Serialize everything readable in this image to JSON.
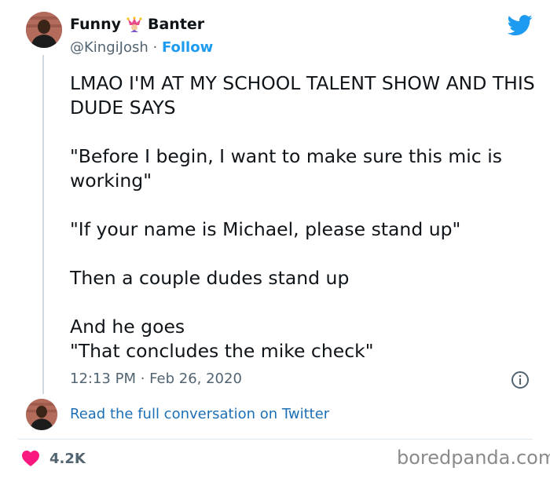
{
  "author": {
    "display_name_first": "Funny",
    "display_name_second": "Banter",
    "handle": "@KingiJosh",
    "separator": "·",
    "follow_label": "Follow",
    "avatar_icon": "user-avatar"
  },
  "tweet": {
    "lines": [
      "LMAO I'M AT MY SCHOOL TALENT SHOW AND THIS DUDE SAYS",
      "\"Before I begin, I want to make sure this mic is working\"",
      "\"If your name is Michael, please stand up\"",
      "Then a couple dudes stand up",
      "And he goes",
      "\"That concludes the mike check\""
    ],
    "timestamp": "12:13 PM · Feb 26, 2020"
  },
  "actions": {
    "read_conversation_label": "Read the full conversation on Twitter",
    "like_count": "4.2K"
  },
  "icons": {
    "brand": "twitter-bird-icon",
    "info": "info-icon",
    "like": "heart-icon",
    "name_emoji": "jester-emoji-icon"
  },
  "colors": {
    "twitter_blue": "#1d9bf0",
    "link_blue": "#1d6fb5",
    "heart_pink": "#f91880",
    "muted_text": "#536471"
  },
  "watermark": "boredpanda.com"
}
